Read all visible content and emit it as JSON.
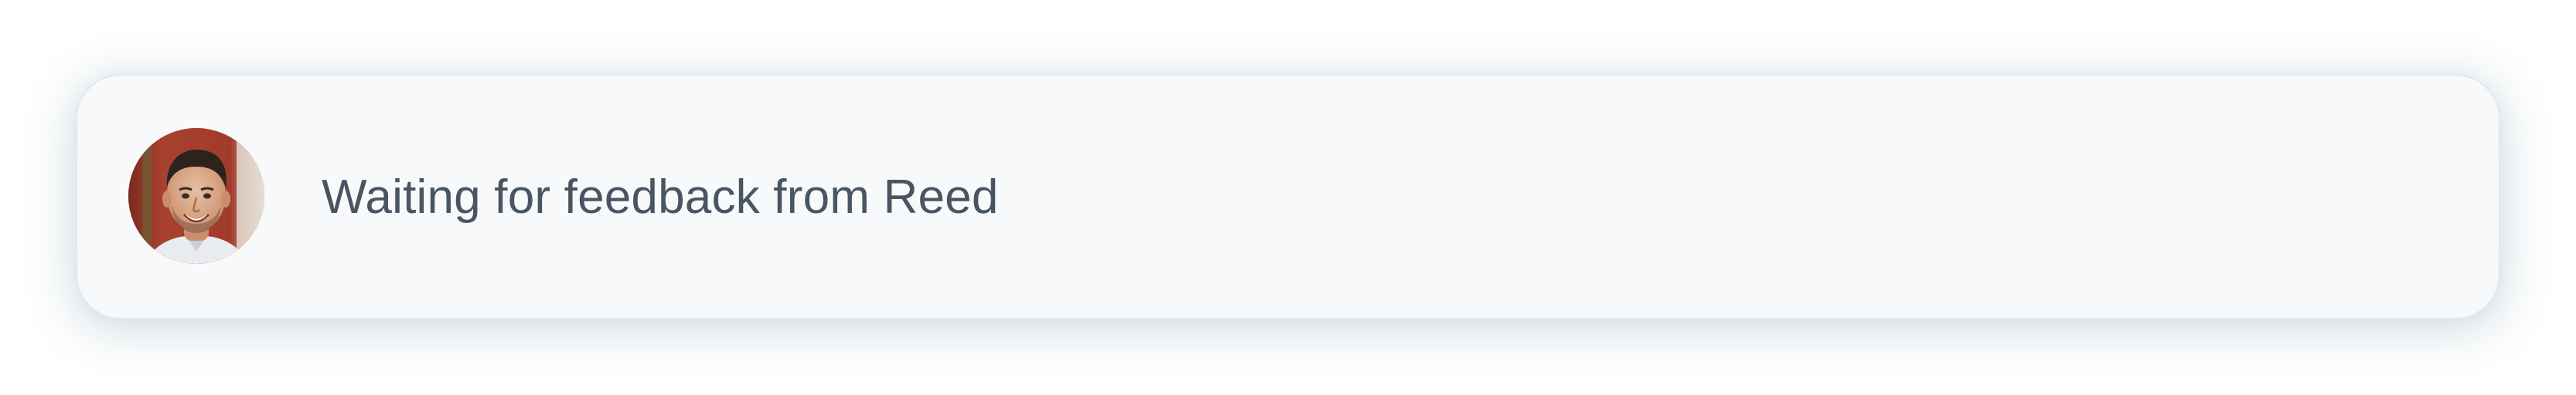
{
  "notification": {
    "message": "Waiting for feedback from Reed",
    "avatar_icon": "user-avatar-photo"
  },
  "colors": {
    "card_background": "#f7f9fb",
    "text": "#4a5563",
    "shadow": "#60879b"
  }
}
